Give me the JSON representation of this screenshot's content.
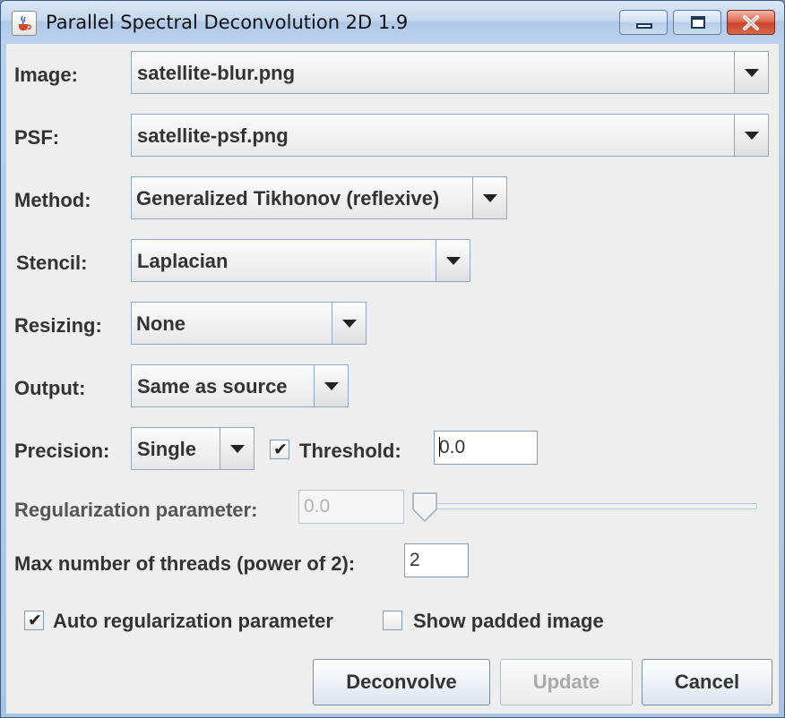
{
  "window": {
    "title": "Parallel Spectral Deconvolution 2D 1.9"
  },
  "form": {
    "image": {
      "label": "Image:",
      "value": "satellite-blur.png"
    },
    "psf": {
      "label": "PSF:",
      "value": "satellite-psf.png"
    },
    "method": {
      "label": "Method:",
      "value": "Generalized Tikhonov (reflexive)"
    },
    "stencil": {
      "label": "Stencil:",
      "value": "Laplacian"
    },
    "resizing": {
      "label": "Resizing:",
      "value": "None"
    },
    "output": {
      "label": "Output:",
      "value": "Same as source"
    },
    "precision": {
      "label": "Precision:",
      "value": "Single"
    },
    "threshold": {
      "label": "Threshold:",
      "checked": true,
      "value": "0.0"
    },
    "regularization": {
      "label": "Regularization parameter:",
      "value": "0.0",
      "slider_fraction": 0.0
    },
    "threads": {
      "label": "Max number of threads (power of 2):",
      "value": "2"
    },
    "auto_regularization": {
      "label": "Auto regularization parameter",
      "checked": true
    },
    "show_padded": {
      "label": "Show padded image",
      "checked": false
    }
  },
  "buttons": {
    "deconvolve": "Deconvolve",
    "update": "Update",
    "cancel": "Cancel"
  },
  "icons": {
    "app": "java-cup-icon",
    "minimize": "minimize-icon",
    "maximize": "maximize-icon",
    "close": "close-icon",
    "check": "✔"
  }
}
